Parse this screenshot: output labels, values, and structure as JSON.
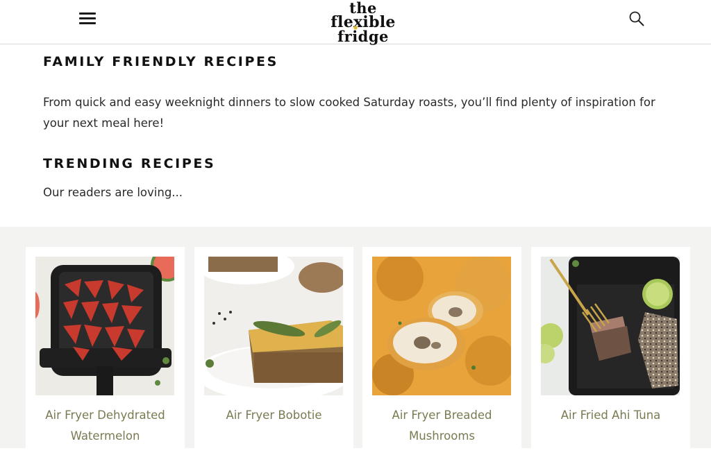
{
  "header": {
    "logo_line1": "the",
    "logo_line2": "flexible",
    "logo_line3": "fridge",
    "menu_icon": "hamburger-menu-icon",
    "search_icon": "search-icon"
  },
  "main": {
    "heading": "FAMILY FRIENDLY RECIPES",
    "intro": "From quick and easy weeknight dinners to slow cooked Saturday roasts, you’ll find plenty of inspiration for your next meal here!",
    "trending_heading": "TRENDING RECIPES",
    "trending_sub": "Our readers are loving..."
  },
  "recipes": [
    {
      "title": "Air Fryer Dehydrated Watermelon"
    },
    {
      "title": "Air Fryer Bobotie"
    },
    {
      "title": "Air Fryer Breaded Mushrooms"
    },
    {
      "title": "Air Fried Ahi Tuna"
    }
  ],
  "colors": {
    "title_link": "#7a7a52",
    "gallery_bg": "#f3f3f1",
    "logo_dot": "#e8b923"
  }
}
